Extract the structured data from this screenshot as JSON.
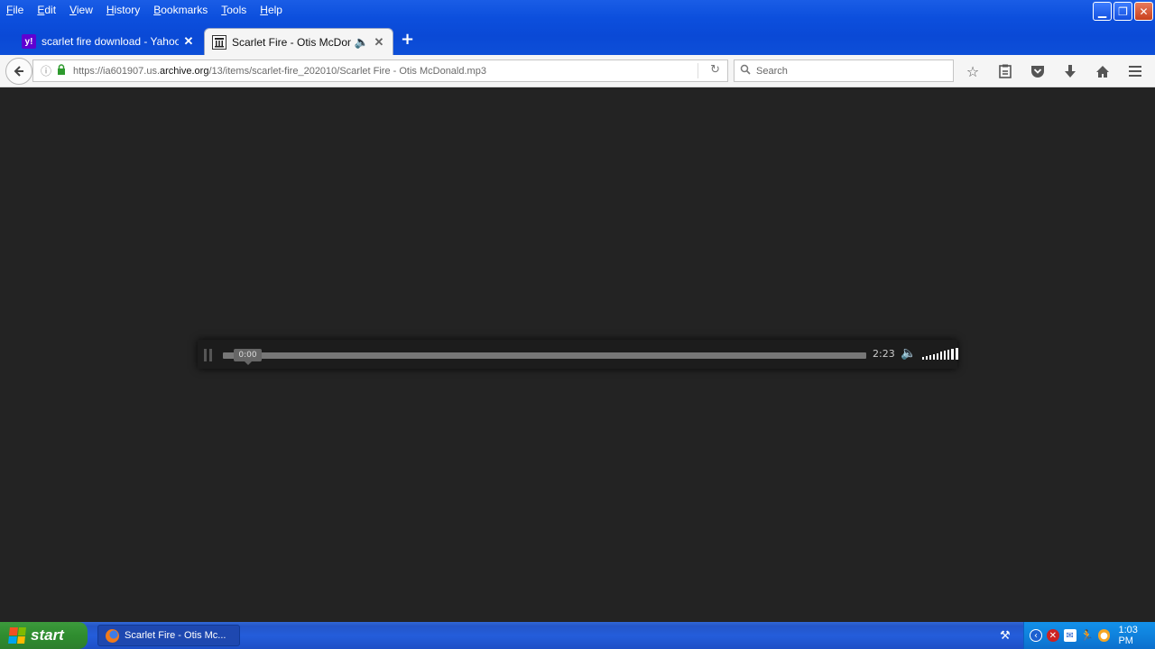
{
  "menubar": {
    "items": [
      {
        "label": "File",
        "key": "F",
        "rest": "ile"
      },
      {
        "label": "Edit",
        "key": "E",
        "rest": "dit"
      },
      {
        "label": "View",
        "key": "V",
        "rest": "iew"
      },
      {
        "label": "History",
        "key": "H",
        "rest": "istory"
      },
      {
        "label": "Bookmarks",
        "key": "B",
        "rest": "ookmarks"
      },
      {
        "label": "Tools",
        "key": "T",
        "rest": "ools"
      },
      {
        "label": "Help",
        "key": "H",
        "rest": "elp"
      }
    ]
  },
  "tabs": {
    "inactive_title": "scarlet fire download - Yahoo ...",
    "active_title": "Scarlet Fire - Otis McDon..."
  },
  "address": {
    "prefix": "https://ia601907.us.",
    "domain": "archive.org",
    "path": "/13/items/scarlet-fire_202010/Scarlet Fire - Otis McDonald.mp3"
  },
  "search": {
    "placeholder": "Search"
  },
  "player": {
    "current_time": "0:00",
    "duration": "2:23",
    "progress": 0
  },
  "taskbar": {
    "start_label": "start",
    "task_label": "Scarlet Fire - Otis Mc...",
    "clock": "1:03 PM"
  },
  "icons": {
    "back": "back-arrow-icon",
    "bookmark": "star-icon",
    "reading_list": "clipboard-icon",
    "pocket": "pocket-icon",
    "downloads": "download-icon",
    "home": "home-icon",
    "menu": "hamburger-menu-icon"
  }
}
